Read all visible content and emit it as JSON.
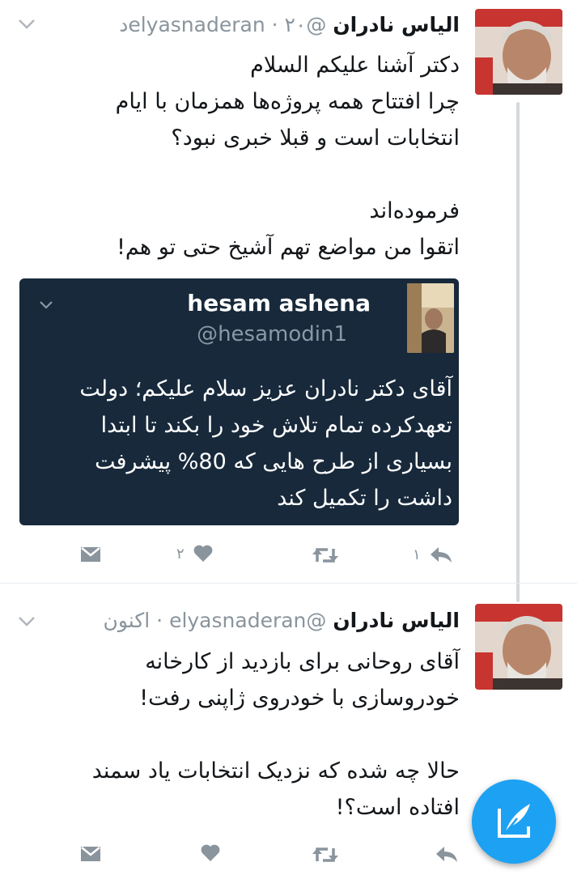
{
  "tweets": [
    {
      "author_name": "الیاس نادران",
      "handle": "@elyasnaderan",
      "separator": "·",
      "time": "۲۰د",
      "lines": [
        "دکتر آشنا علیکم السلام",
        "چرا افتتاح همه پروژه‌ها همزمان با ایام",
        "انتخابات است و قبلا خبری نبود؟",
        "",
        "فرموده‌اند",
        "اتقوا من مواضع تهم آشیخ حتی تو هم!"
      ],
      "quoted": {
        "author_name": "hesam ashena",
        "handle": "@hesamodin1",
        "lines": [
          "آقای دکتر نادران عزیز سلام علیکم؛ دولت",
          "تعهدکرده تمام تلاش خود را بکند تا ابتدا",
          "بسیاری از طرح هایی که 80% پیشرفت",
          "داشت را تکمیل کند"
        ]
      },
      "reply_count": "۱",
      "like_count": "۲"
    },
    {
      "author_name": "الیاس نادران",
      "handle": "@elyasnaderan",
      "separator": "·",
      "time": "اکنون",
      "lines": [
        "آقای روحانی برای بازدید از کارخانه",
        "خودروسازی با خودروی ژاپنی رفت!",
        "",
        "حالا چه شده که نزدیک انتخابات یاد سمند",
        "افتاده است؟!"
      ]
    }
  ],
  "colors": {
    "accent": "#1da1f2",
    "quote_bg": "#17293b",
    "muted": "#8a949c",
    "thread_line": "#d4d9de"
  },
  "icons": [
    "chevron-down-icon",
    "reply-icon",
    "retweet-icon",
    "like-icon",
    "dm-icon",
    "compose-icon"
  ]
}
